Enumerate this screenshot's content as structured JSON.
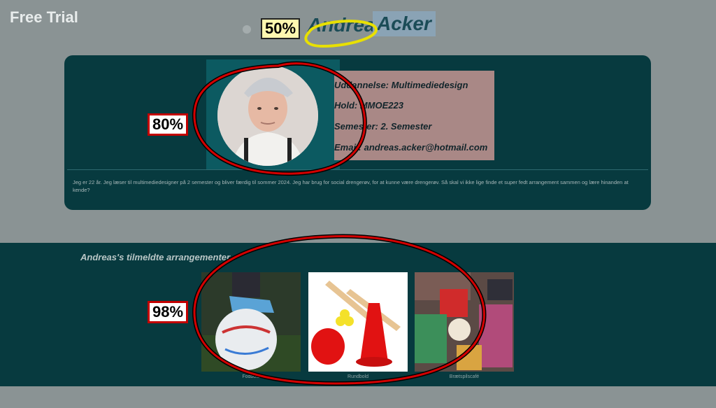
{
  "watermark": "Free Trial",
  "profile": {
    "first_name": "Andreas",
    "last_name": "Acker",
    "education": "Uddannelse: Multimediedesign",
    "class": "Hold: MMOE223",
    "semester": "Semester: 2. Semester",
    "email": "Email: andreas.acker@hotmail.com",
    "bio": "Jeg er 22 år. Jeg læser til multimediedesigner på 2 semester og bliver færdig til sommer 2024. Jeg har brug for social drengerøv, for at kunne være drengerøv. Så skal vi ikke lige finde et super fedt arrangement sammen og lære hinanden at kende?"
  },
  "events": {
    "title": "Andreas's tilmeldte arrangementer",
    "items": [
      {
        "caption": "Fodbold"
      },
      {
        "caption": "Rundbold"
      },
      {
        "caption": "Brætspilscafé"
      }
    ]
  },
  "badges": {
    "name": "50%",
    "avatar": "80%",
    "events": "98%"
  },
  "colors": {
    "page_bg": "#8a9394",
    "card_bg": "#073a3f",
    "highlight_red": "#c30000",
    "highlight_yellow": "#fff8b0"
  }
}
